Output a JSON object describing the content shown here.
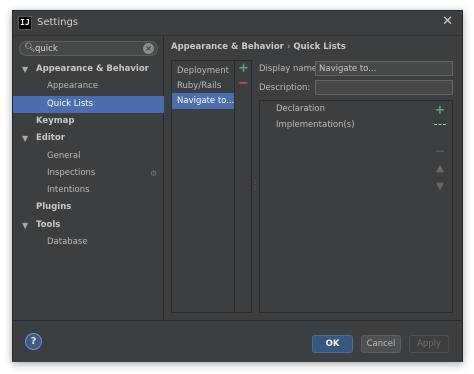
{
  "window": {
    "title": "Settings",
    "app_icon_text": "IJ",
    "close_glyph": "✕"
  },
  "search": {
    "value": "quick",
    "placeholder": ""
  },
  "tree": [
    {
      "label": "Appearance & Behavior",
      "level": 0,
      "bold": true,
      "arrow": "▼"
    },
    {
      "label": "Appearance",
      "level": 1
    },
    {
      "label": "Quick Lists",
      "level": 1,
      "selected": true
    },
    {
      "label": "Keymap",
      "level": 0,
      "bold": true
    },
    {
      "label": "Editor",
      "level": 0,
      "bold": true,
      "arrow": "▼"
    },
    {
      "label": "General",
      "level": 1
    },
    {
      "label": "Inspections",
      "level": 1,
      "has_icon": true
    },
    {
      "label": "Intentions",
      "level": 1
    },
    {
      "label": "Plugins",
      "level": 0,
      "bold": true
    },
    {
      "label": "Tools",
      "level": 0,
      "bold": true,
      "arrow": "▼"
    },
    {
      "label": "Database",
      "level": 1
    }
  ],
  "breadcrumb": {
    "parent": "Appearance & Behavior",
    "separator": "›",
    "current": "Quick Lists"
  },
  "quick_lists": {
    "items": [
      "Deployment",
      "Ruby/Rails",
      "Navigate to..."
    ],
    "selected_index": 2
  },
  "form": {
    "display_name_label": "Display name:",
    "display_name_value": "Navigate to...",
    "description_label": "Description:",
    "description_value": ""
  },
  "actions": [
    "Declaration",
    "Implementation(s)"
  ],
  "footer": {
    "help_label": "?",
    "ok_label": "OK",
    "cancel_label": "Cancel",
    "apply_label": "Apply"
  },
  "colors": {
    "background": "#3c3f41",
    "selection": "#4b6eaf",
    "add": "#59a869",
    "remove": "#c75450",
    "default_button": "#365880"
  }
}
